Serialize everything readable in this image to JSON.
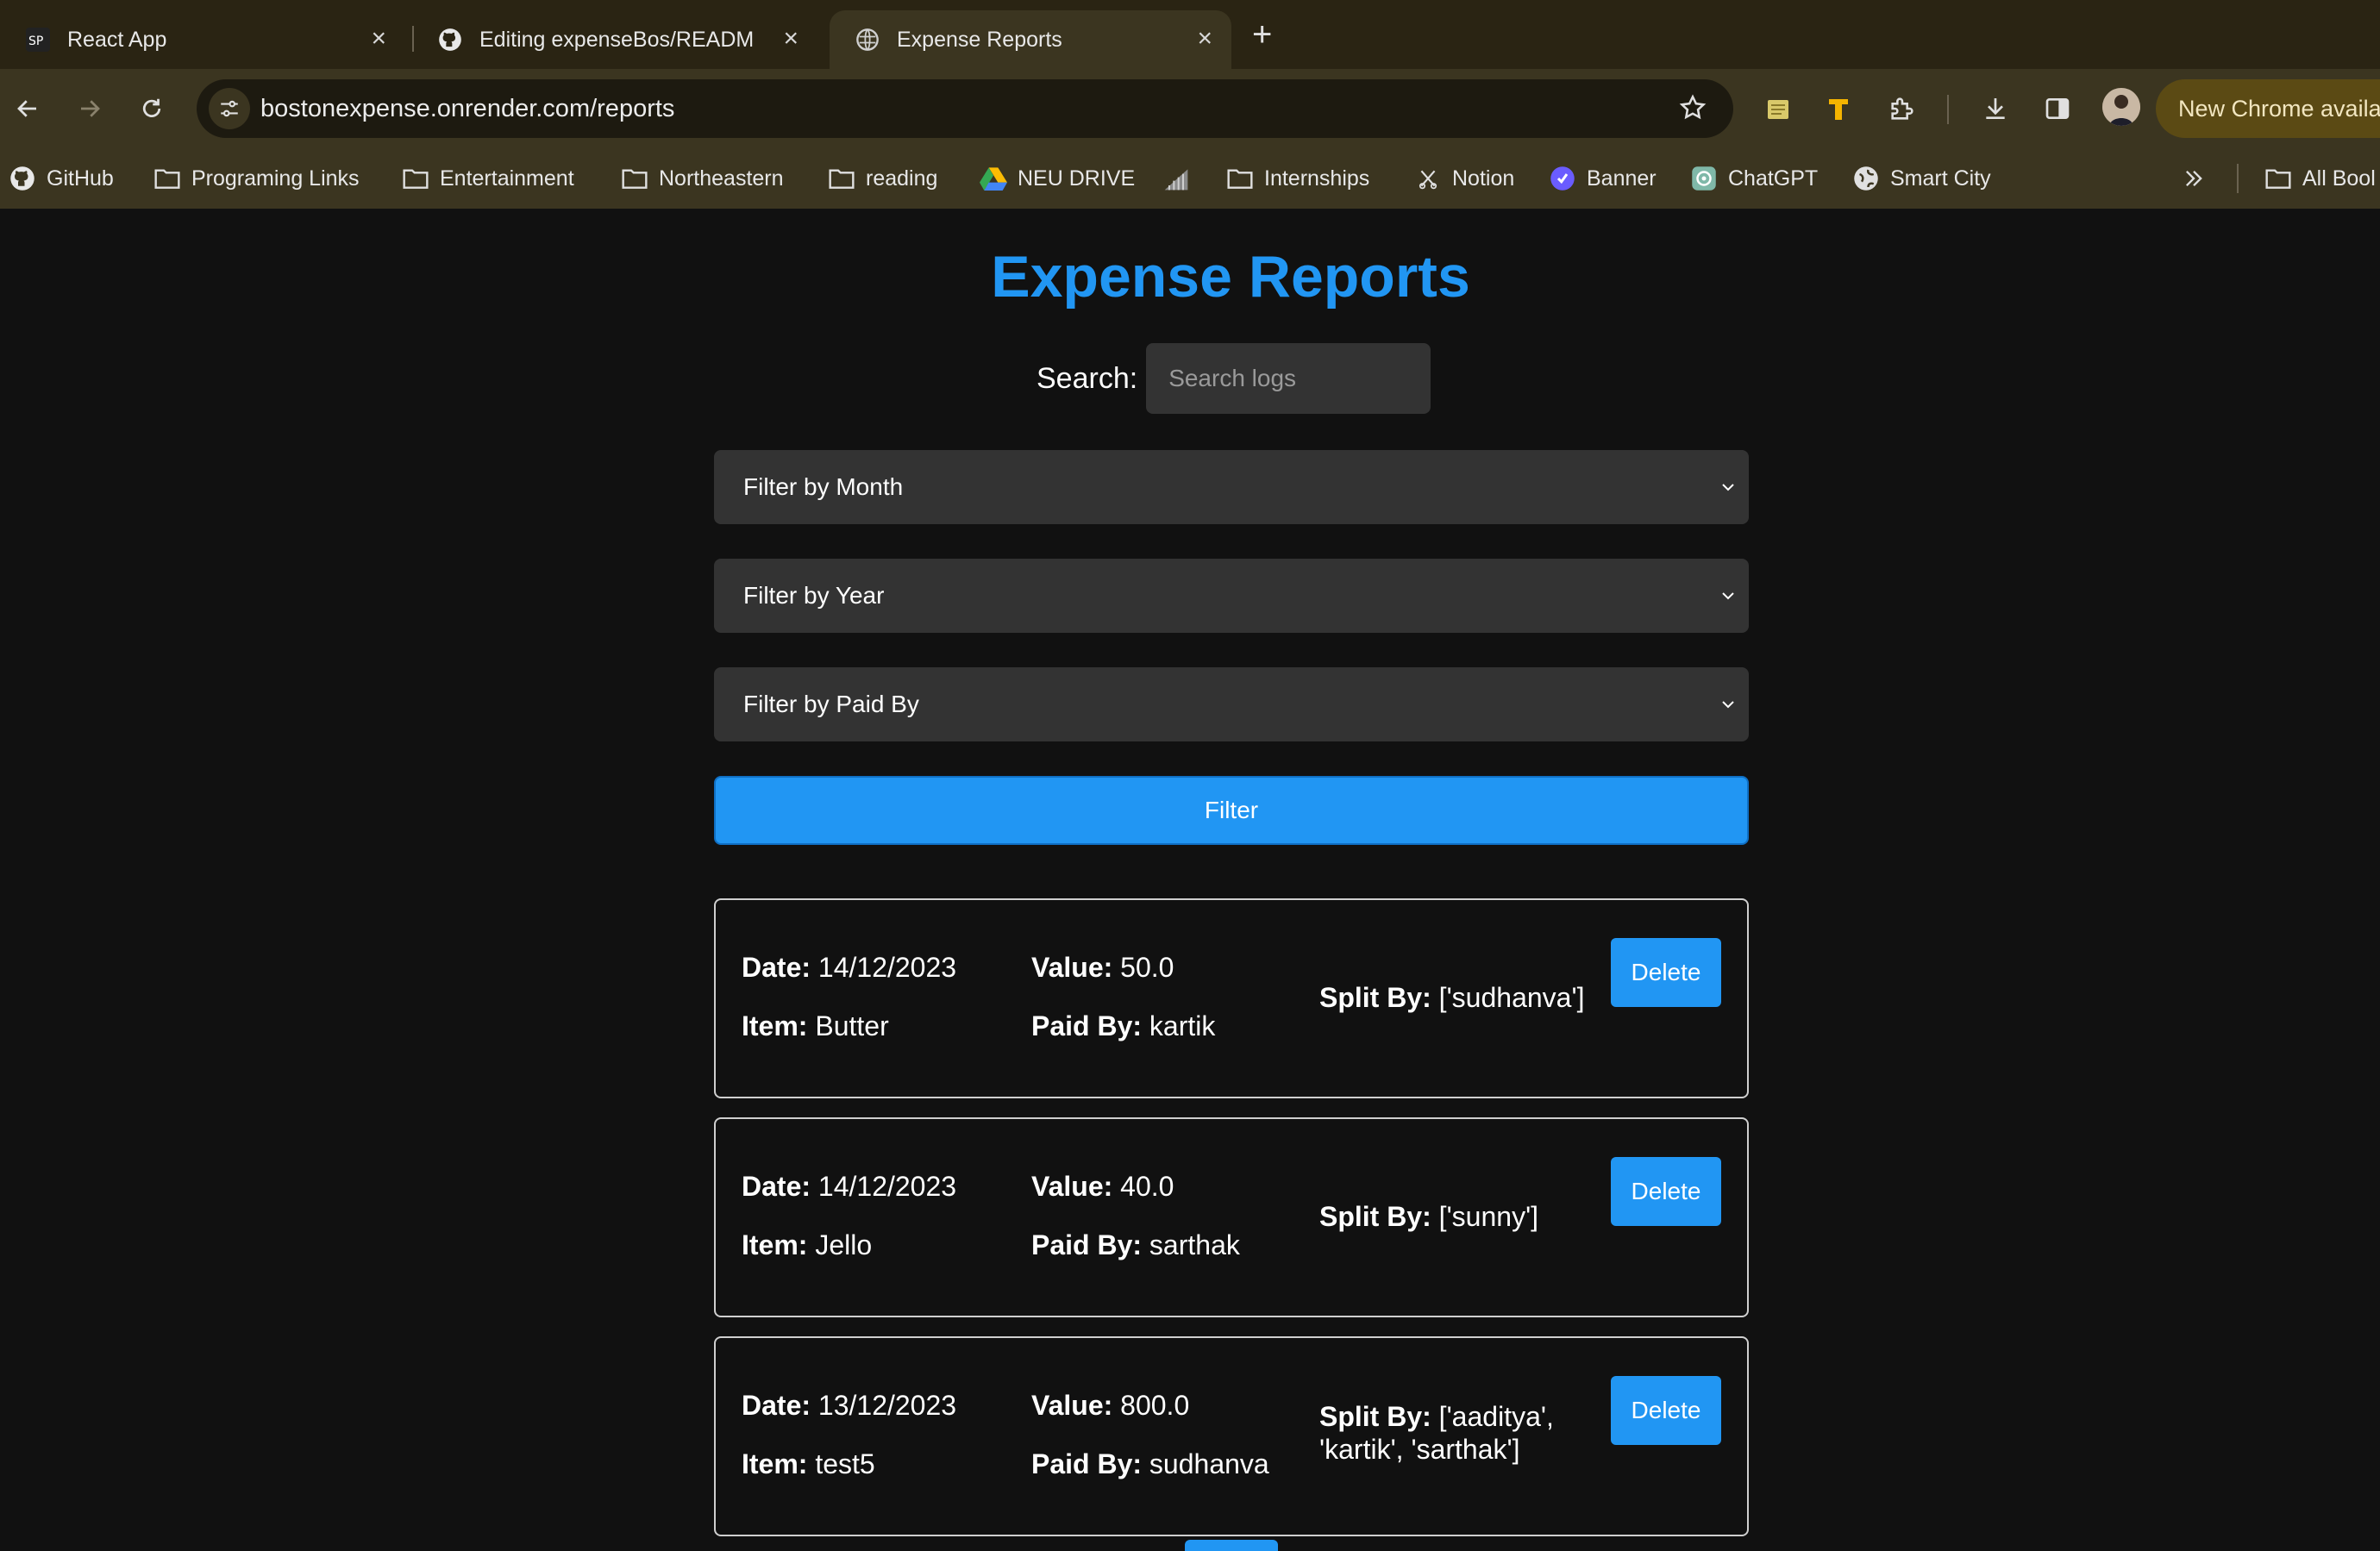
{
  "browser": {
    "tabs": [
      {
        "title": "React App"
      },
      {
        "title": "Editing expenseBos/README"
      },
      {
        "title": "Expense Reports"
      }
    ],
    "url": "bostonexpense.onrender.com/reports",
    "update_banner": "New Chrome availa",
    "bookmarks": [
      {
        "label": "GitHub",
        "icon": "github-icon"
      },
      {
        "label": "Programing Links",
        "icon": "folder-icon"
      },
      {
        "label": "Entertainment",
        "icon": "folder-icon"
      },
      {
        "label": "Northeastern",
        "icon": "folder-icon"
      },
      {
        "label": "reading",
        "icon": "folder-icon"
      },
      {
        "label": "NEU DRIVE",
        "icon": "drive-icon"
      },
      {
        "label": "",
        "icon": "chart-icon"
      },
      {
        "label": "Internships",
        "icon": "folder-icon"
      },
      {
        "label": "Notion",
        "icon": "notion-icon"
      },
      {
        "label": "Banner",
        "icon": "banner-icon"
      },
      {
        "label": "ChatGPT",
        "icon": "chatgpt-icon"
      },
      {
        "label": "Smart City",
        "icon": "globe-icon"
      }
    ],
    "all_bookmarks": "All Bool"
  },
  "page": {
    "title": "Expense Reports",
    "search": {
      "label": "Search:",
      "placeholder": "Search logs"
    },
    "filters": {
      "month": "Filter by Month",
      "year": "Filter by Year",
      "paid_by": "Filter by Paid By",
      "button": "Filter"
    },
    "labels": {
      "date": "Date:",
      "item": "Item:",
      "value": "Value:",
      "paid_by": "Paid By:",
      "split_by": "Split By:",
      "delete": "Delete"
    },
    "expenses": [
      {
        "date": "14/12/2023",
        "item": "Butter",
        "value": "50.0",
        "paid_by": "kartik",
        "split_by": "['sudhanva']"
      },
      {
        "date": "14/12/2023",
        "item": "Jello",
        "value": "40.0",
        "paid_by": "sarthak",
        "split_by": "['sunny']"
      },
      {
        "date": "13/12/2023",
        "item": "test5",
        "value": "800.0",
        "paid_by": "sudhanva",
        "split_by": "['aaditya', 'kartik', 'sarthak']"
      }
    ]
  },
  "colors": {
    "accent": "#2196f3",
    "background": "#111111",
    "field": "#333333"
  }
}
